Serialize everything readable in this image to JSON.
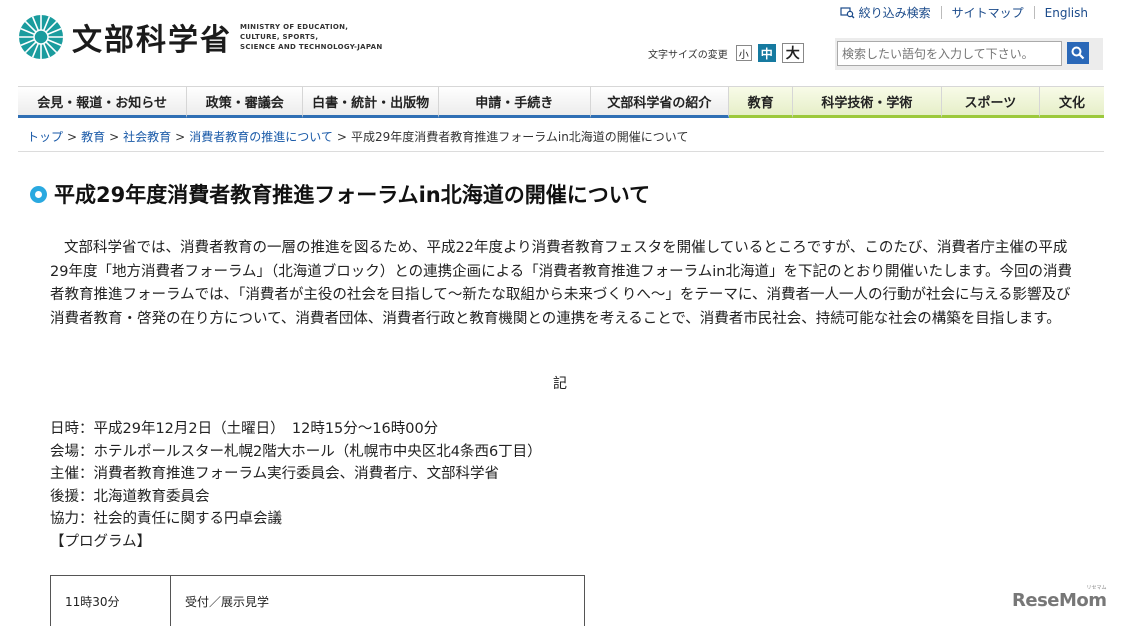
{
  "header": {
    "logo_jp": "文部科学省",
    "logo_en": [
      "MINISTRY OF EDUCATION,",
      "CULTURE, SPORTS,",
      "SCIENCE AND TECHNOLOGY-JAPAN"
    ],
    "util_links": {
      "filter_search": "絞り込み検索",
      "sitemap": "サイトマップ",
      "english": "English"
    },
    "font_size": {
      "label": "文字サイズの変更",
      "small": "小",
      "medium": "中",
      "large": "大",
      "selected": "中"
    },
    "search": {
      "placeholder": "検索したい語句を入力して下さい。"
    }
  },
  "nav": {
    "items": [
      "会見・報道・お知らせ",
      "政策・審議会",
      "白書・統計・出版物",
      "申請・手続き",
      "文部科学省の紹介",
      "教育",
      "科学技術・学術",
      "スポーツ",
      "文化"
    ]
  },
  "breadcrumb": {
    "links": [
      "トップ",
      "教育",
      "社会教育",
      "消費者教育の推進について"
    ],
    "current": "平成29年度消費者教育推進フォーラムin北海道の開催について"
  },
  "main": {
    "title": "平成29年度消費者教育推進フォーラムin北海道の開催について",
    "intro": "文部科学省では、消費者教育の一層の推進を図るため、平成22年度より消費者教育フェスタを開催しているところですが、このたび、消費者庁主催の平成29年度「地方消費者フォーラム」（北海道ブロック）との連携企画による「消費者教育推進フォーラムin北海道」を下記のとおり開催いたします。今回の消費者教育推進フォーラムでは、「消費者が主役の社会を目指して〜新たな取組から未来づくりへ〜」をテーマに、消費者一人一人の行動が社会に与える影響及び消費者教育・啓発の在り方について、消費者団体、消費者行政と教育機関との連携を考えることで、消費者市民社会、持続可能な社会の構築を目指します。",
    "ki": "記",
    "details": {
      "date": "日時：平成29年12月2日（土曜日）　12時15分〜16時00分",
      "venue": "会場：ホテルポールスター札幌2階大ホール（札幌市中央区北4条西6丁目）",
      "host": "主催：消費者教育推進フォーラム実行委員会、消費者庁、文部科学省",
      "support": "後援：北海道教育委員会",
      "cooperation": "協力：社会的責任に関する円卓会議",
      "program_heading": "【プログラム】"
    },
    "program": [
      {
        "time": "11時30分",
        "item": "受付／展示見学"
      }
    ]
  },
  "watermark": {
    "text": "ReseMom",
    "sub": "リセマム"
  },
  "colors": {
    "nav_blue": "#2f6fb4",
    "nav_green": "#9cc93c",
    "title_dot": "#2aa9e0",
    "link": "#1a5aa8",
    "search_button": "#2a68b8"
  }
}
